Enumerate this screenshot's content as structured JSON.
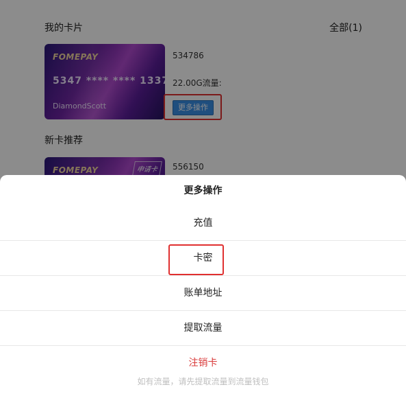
{
  "my_cards": {
    "title": "我的卡片",
    "all_link": "全部(1)",
    "card": {
      "brand": "FOMEPAY",
      "number": "5347  ****  ****  1337",
      "holder": "DiamondScott",
      "id": "534786",
      "traffic": "22.00G流量:",
      "more_button": "更多操作"
    }
  },
  "recommended": {
    "title": "新卡推荐",
    "card": {
      "brand": "FOMEPAY",
      "apply_tag": "申请卡",
      "id": "556150"
    }
  },
  "sheet": {
    "title": "更多操作",
    "items": [
      "充值",
      "卡密",
      "账单地址",
      "提取流量"
    ],
    "danger_item": "注销卡",
    "note": "如有流量，请先提取流量到流量钱包"
  },
  "colors": {
    "accent": "#3a8ee6",
    "danger": "#d93a3a",
    "highlight": "#e03030"
  }
}
